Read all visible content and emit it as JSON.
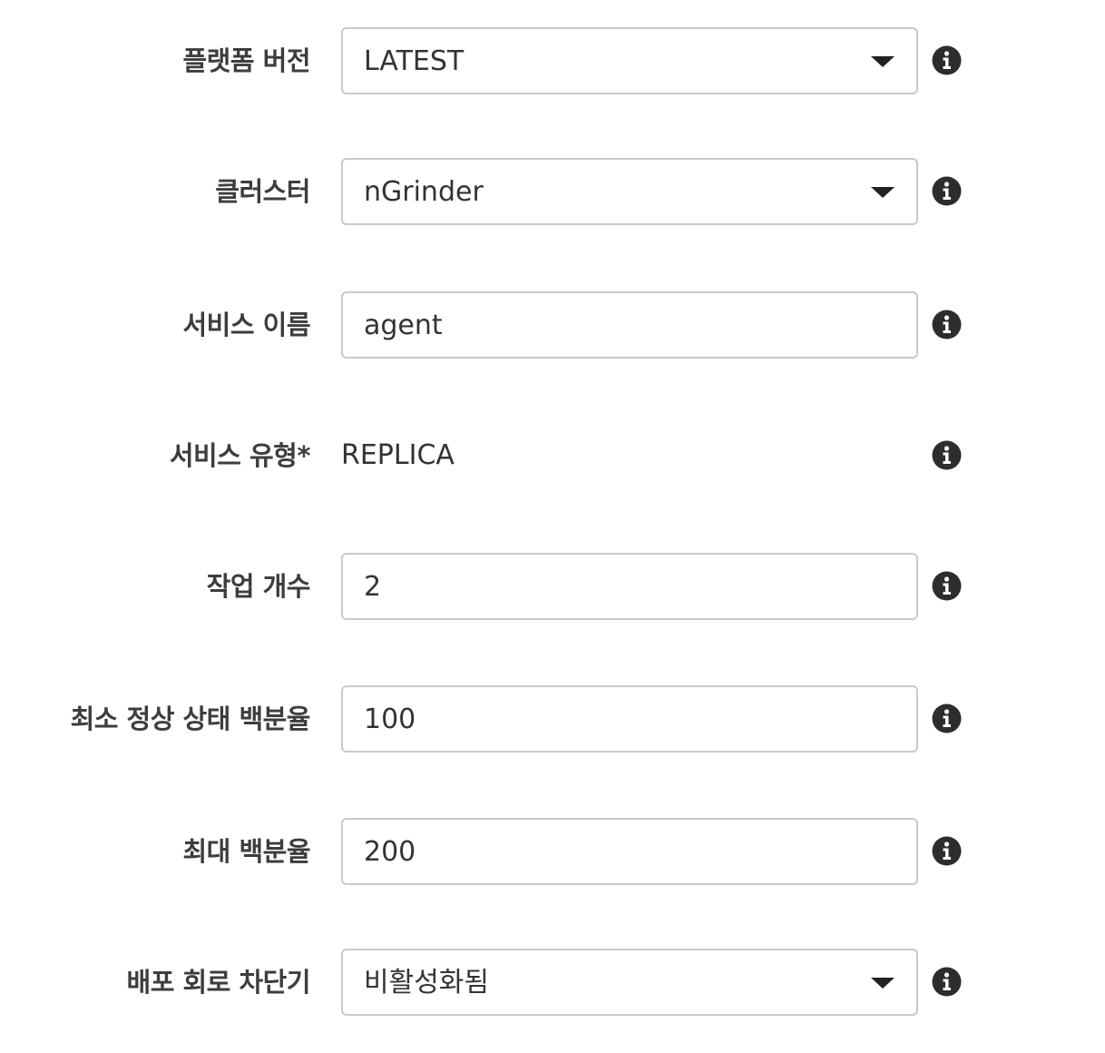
{
  "form": {
    "rows": [
      {
        "key": "platform_version",
        "label": "플랫폼 버전",
        "type": "select",
        "value": "LATEST"
      },
      {
        "key": "cluster",
        "label": "클러스터",
        "type": "select",
        "value": "nGrinder"
      },
      {
        "key": "service_name",
        "label": "서비스 이름",
        "type": "input",
        "value": "agent"
      },
      {
        "key": "service_type",
        "label": "서비스 유형*",
        "type": "static",
        "value": "REPLICA"
      },
      {
        "key": "task_count",
        "label": "작업 개수",
        "type": "input",
        "value": "2"
      },
      {
        "key": "min_healthy_percent",
        "label": "최소 정상 상태 백분율",
        "type": "input",
        "value": "100"
      },
      {
        "key": "max_percent",
        "label": "최대 백분율",
        "type": "input",
        "value": "200"
      },
      {
        "key": "deployment_circuit_breaker",
        "label": "배포 회로 차단기",
        "type": "select",
        "value": "비활성화됨"
      }
    ]
  },
  "icons": {
    "info": "info-circle-icon",
    "dropdown": "caret-down-icon"
  },
  "colors": {
    "label": "#3d3d3d",
    "text": "#333333",
    "border": "#c9c9c9",
    "icon": "#2d2d2d"
  }
}
